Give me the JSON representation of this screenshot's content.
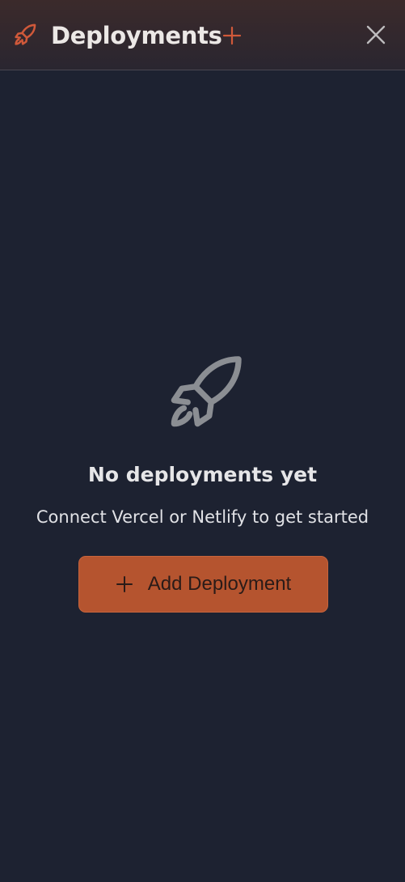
{
  "header": {
    "title": "Deployments",
    "icon": "rocket-icon",
    "add_icon": "plus-icon",
    "close_icon": "close-icon"
  },
  "empty_state": {
    "icon": "rocket-icon",
    "title": "No deployments yet",
    "subtitle": "Connect Vercel or Netlify to get started",
    "button_label": "Add Deployment",
    "button_icon": "plus-icon"
  },
  "colors": {
    "background": "#1d2231",
    "accent": "#b5542f",
    "header_icon": "#d0593a",
    "muted_icon": "#8b8e93"
  }
}
